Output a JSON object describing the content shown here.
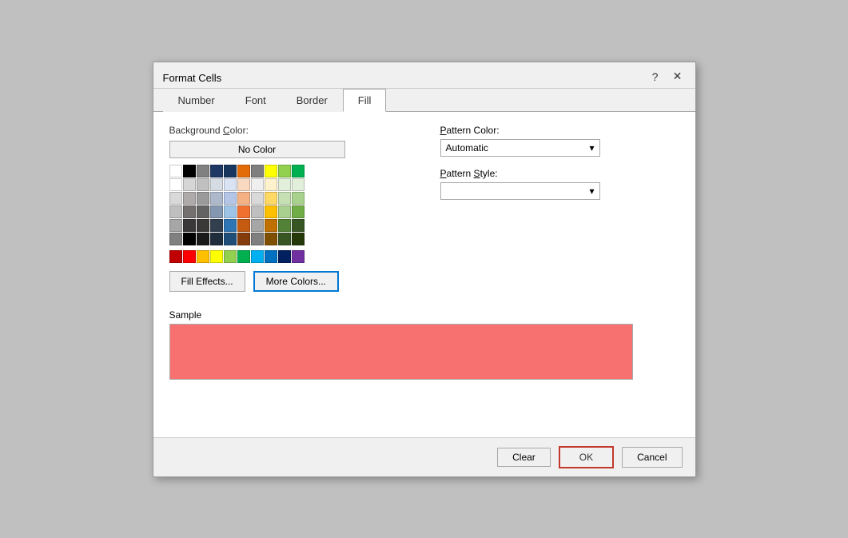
{
  "dialog": {
    "title": "Format Cells",
    "help_btn": "?",
    "close_btn": "✕"
  },
  "tabs": [
    {
      "label": "Number",
      "active": false
    },
    {
      "label": "Font",
      "active": false
    },
    {
      "label": "Border",
      "active": false
    },
    {
      "label": "Fill",
      "active": true
    }
  ],
  "fill_tab": {
    "background_color_label": "Background Color:",
    "no_color_btn": "No Color",
    "pattern_color_label": "Pattern Color:",
    "pattern_color_value": "Automatic",
    "pattern_style_label": "Pattern Style:",
    "pattern_style_value": "",
    "fill_effects_btn": "Fill Effects...",
    "more_colors_btn": "More Colors...",
    "sample_label": "Sample",
    "sample_bg": "#f87171",
    "clear_btn": "Clear",
    "ok_btn": "OK",
    "cancel_btn": "Cancel"
  },
  "color_grid_row1": [
    "#ffffff",
    "#000000",
    "#808080",
    "#1f3864",
    "#17375e",
    "#e36c09",
    "#7f7f7f",
    "#ffff00",
    "#92d050",
    "#00b050"
  ],
  "color_grid_rows": [
    [
      "#ffffff",
      "#595959",
      "#7f7f7f",
      "#d6dce4",
      "#dae3f3",
      "#fad9c1",
      "#efefef",
      "#fef2cc",
      "#e2efda",
      "#e2efda"
    ],
    [
      "#d9d9d9",
      "#404040",
      "#595959",
      "#adb9ca",
      "#b4c6e7",
      "#f4b183",
      "#d9d9d9",
      "#ffd966",
      "#c6e0b4",
      "#a9d18e"
    ],
    [
      "#bfbfbf",
      "#262626",
      "#404040",
      "#8497b0",
      "#9dc3e6",
      "#f07030",
      "#bfbfbf",
      "#ffc000",
      "#a9d08e",
      "#70ad47"
    ],
    [
      "#a6a6a6",
      "#0d0d0d",
      "#262626",
      "#323f4f",
      "#2e75b6",
      "#c55a11",
      "#a6a6a6",
      "#c07000",
      "#538135",
      "#375623"
    ],
    [
      "#808080",
      "#000000",
      "#0d0d0d",
      "#1f2d3d",
      "#1f4e79",
      "#843c0c",
      "#7f7f7f",
      "#7f4f00",
      "#375623",
      "#243808"
    ]
  ],
  "color_grid_bright": [
    "#ff0000",
    "#ff0000",
    "#ffff00",
    "#92d050",
    "#00b050",
    "#00b0f0",
    "#0070c0",
    "#002060",
    "#7030a0",
    "#7030a0"
  ]
}
